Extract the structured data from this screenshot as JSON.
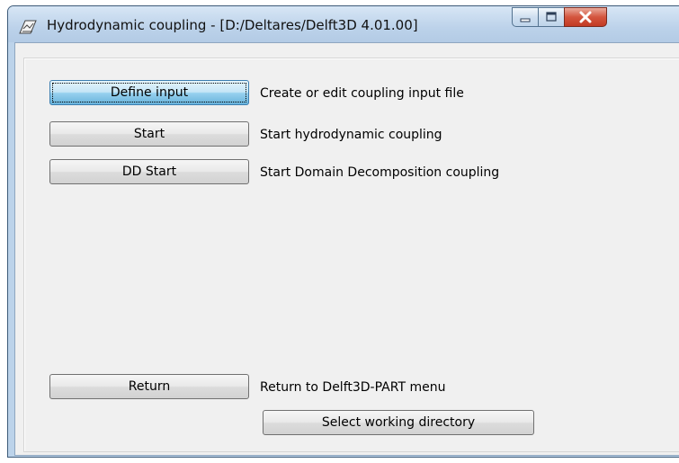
{
  "window": {
    "title": "Hydrodynamic coupling - [D:/Deltares/Delft3D 4.01.00]",
    "icon": "delft3d-app-icon",
    "controls": {
      "minimize": "minimize-icon",
      "maximize": "maximize-icon",
      "close": "close-icon"
    }
  },
  "actions": [
    {
      "label": "Define input",
      "description": "Create or edit coupling input file"
    },
    {
      "label": "Start",
      "description": "Start hydrodynamic coupling"
    },
    {
      "label": "DD Start",
      "description": "Start Domain Decomposition coupling"
    },
    {
      "label": "Return",
      "description": "Return to Delft3D-PART menu"
    }
  ],
  "select_dir": {
    "label": "Select working directory"
  },
  "colors": {
    "focused_button": "#98d1ef",
    "close_button": "#c23a24",
    "window_frame": "#bcd3ea",
    "client_bg": "#f0f0f0"
  }
}
